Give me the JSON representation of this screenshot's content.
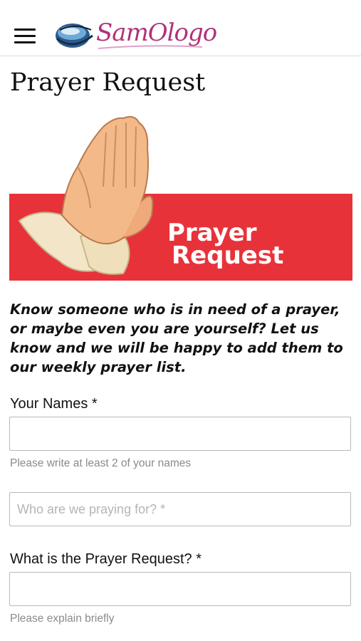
{
  "header": {
    "logo_text": "SamOlogo"
  },
  "page": {
    "title": "Prayer Request"
  },
  "banner": {
    "line1": "Prayer",
    "line2": "Request",
    "colors": {
      "red": "#e8323a",
      "skin": "#f4b989",
      "sleeve": "#f3e6c8"
    }
  },
  "intro": "Know someone who is in need of a prayer, or maybe even you are yourself? Let us know and we will be happy to add them to our weekly prayer list.",
  "form": {
    "names": {
      "label": "Your Names *",
      "value": "",
      "hint": "Please write at least 2  of your names"
    },
    "praying_for": {
      "value": "",
      "placeholder": "Who are we praying for? *"
    },
    "request": {
      "label": "What is the Prayer Request? *",
      "value": "",
      "hint": "Please explain briefly"
    }
  }
}
